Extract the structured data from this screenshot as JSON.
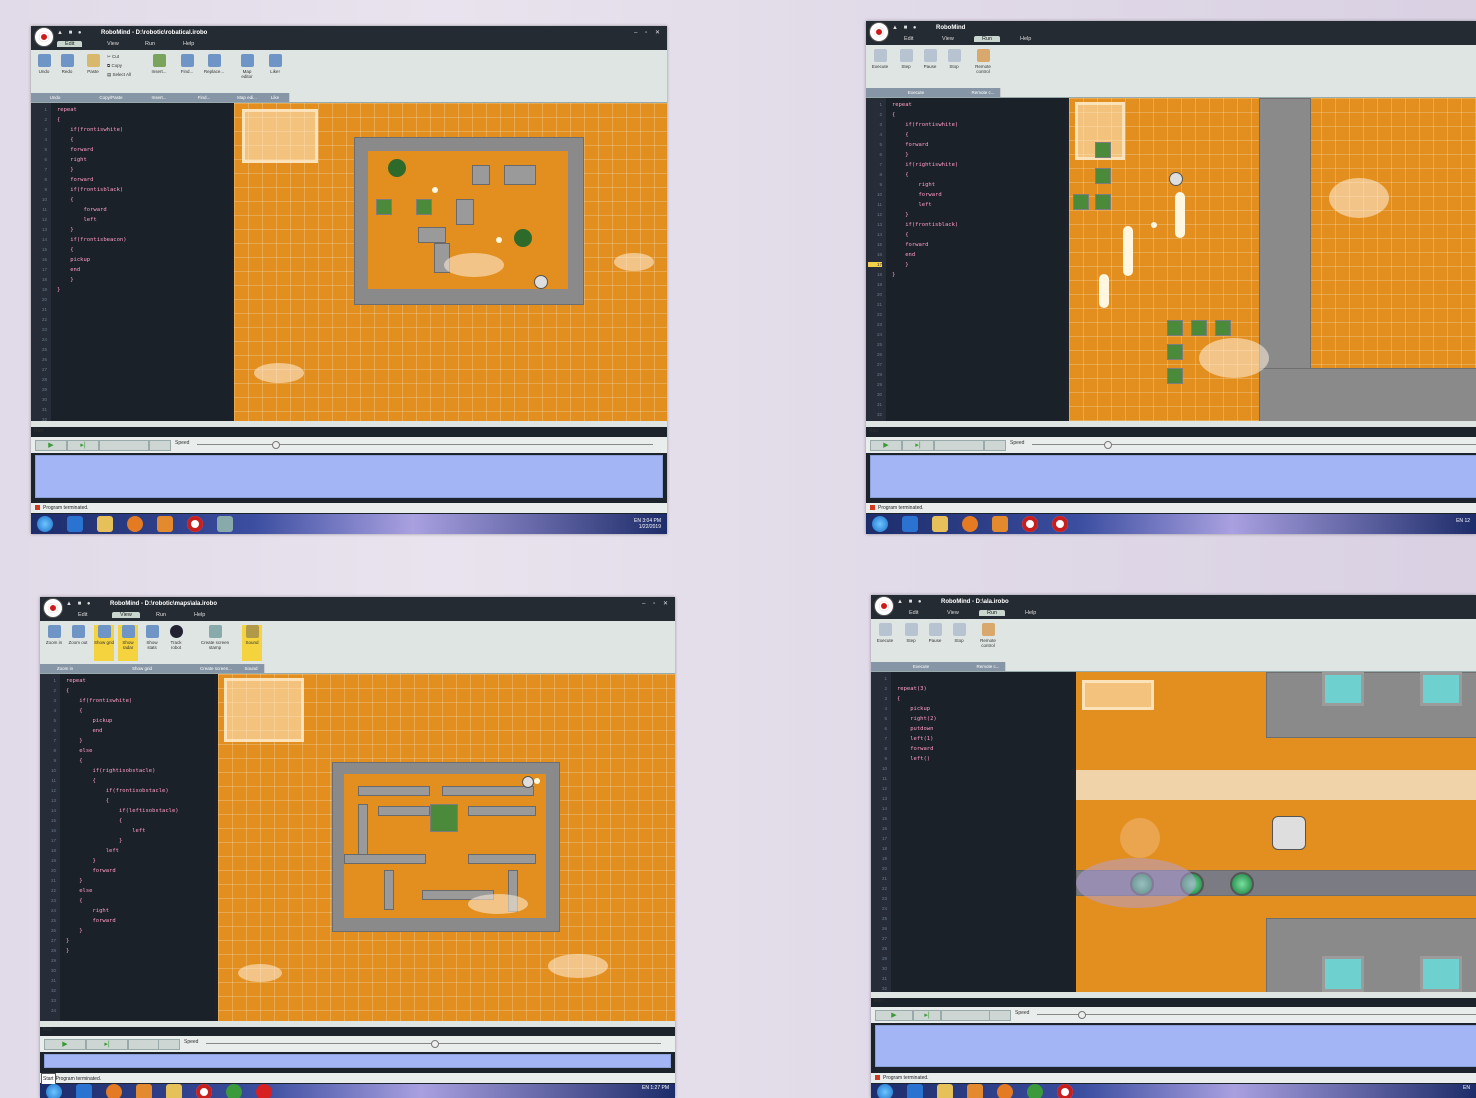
{
  "panels": [
    {
      "app_title": "RoboMind",
      "file_path": "D:\\robotic\\robatical.irobo",
      "menu": [
        "Edit",
        "View",
        "Run",
        "Help"
      ],
      "active_menu": "Edit",
      "ribbon_buttons": [
        "Undo",
        "Redo",
        "Paste",
        "Cut",
        "Copy",
        "Select All",
        "Insert...",
        "Find...",
        "Replace...",
        "Map editor",
        "Like!"
      ],
      "ribbon_groups": [
        "Undo",
        "Copy/Paste",
        "Insert...",
        "Find...",
        "Map edi...",
        "Like"
      ],
      "line_numbers": [
        "1",
        "2",
        "3",
        "4",
        "5",
        "6",
        "7",
        "8",
        "9",
        "10",
        "11",
        "12",
        "13",
        "14",
        "15",
        "16",
        "17",
        "18",
        "19",
        "20",
        "21",
        "22",
        "23",
        "24",
        "25",
        "26",
        "27",
        "28",
        "29",
        "30",
        "31",
        "32"
      ],
      "code": [
        "repeat",
        "{",
        "    if(frontiswhite)",
        "    {",
        "    forward",
        "    right",
        "    }",
        "    forward",
        "    if(frontisblack)",
        "    {",
        "        forward",
        "        left",
        "    }",
        "    if(frontisbeacon)",
        "    {",
        "    pickup",
        "    end",
        "    }",
        "}"
      ],
      "run_label": "Run",
      "speed_label": "Speed",
      "speed_value": 0.17,
      "status_text": "Program terminated.",
      "tray_time": "3:04 PM",
      "tray_date": "1/22/2019",
      "tray_lang": "EN"
    },
    {
      "app_title": "RoboMind",
      "menu": [
        "Edit",
        "View",
        "Run",
        "Help"
      ],
      "active_menu": "Run",
      "ribbon_buttons": [
        "Execute",
        "Step",
        "Pause",
        "Stop",
        "Remote control"
      ],
      "ribbon_groups": [
        "Execute",
        "Remote c..."
      ],
      "line_numbers": [
        "1",
        "2",
        "3",
        "4",
        "5",
        "6",
        "7",
        "8",
        "9",
        "10",
        "11",
        "12",
        "13",
        "14",
        "15",
        "16",
        "17",
        "18",
        "19",
        "20",
        "21",
        "22",
        "23",
        "24",
        "25",
        "26",
        "27",
        "28",
        "29",
        "30",
        "31",
        "32"
      ],
      "code": [
        "repeat",
        "{",
        "    if(frontiswhite)",
        "    {",
        "    forward",
        "    }",
        "    if(rightiswhite)",
        "    {",
        "        right",
        "        forward",
        "        left",
        "    }",
        "    if(frontisblack)",
        "    {",
        "    forward",
        "    end",
        "    }",
        "}"
      ],
      "run_label": "Run",
      "speed_label": "Speed",
      "speed_value": 0.17,
      "status_text": "Program terminated.",
      "tray_time": "12",
      "tray_lang": "EN"
    },
    {
      "app_title": "RoboMind",
      "file_path": "D:\\robotic\\maps\\ala.irobo",
      "menu": [
        "Edit",
        "View",
        "Run",
        "Help"
      ],
      "active_menu": "View",
      "ribbon_buttons": [
        "Zoom in",
        "Zoom out",
        "Show grid",
        "Show radar",
        "Show stats",
        "Track robot",
        "Create screen stamp",
        "Sound"
      ],
      "ribbon_groups": [
        "Zoom in",
        "Show grid",
        "Create screen...",
        "Sound"
      ],
      "line_numbers": [
        "1",
        "2",
        "3",
        "4",
        "5",
        "6",
        "7",
        "8",
        "9",
        "10",
        "11",
        "12",
        "13",
        "14",
        "15",
        "16",
        "17",
        "18",
        "19",
        "20",
        "21",
        "22",
        "23",
        "24",
        "25",
        "26",
        "27",
        "28",
        "29",
        "30",
        "31",
        "32",
        "33",
        "34"
      ],
      "code": [
        "repeat",
        "{",
        "    if(frontiswhite)",
        "    {",
        "        pickup",
        "        end",
        "    }",
        "    else",
        "    {",
        "        if(rightisobstacle)",
        "        {",
        "            if(frontisobstacle)",
        "            {",
        "                if(leftisobstacle)",
        "                {",
        "                    left",
        "                }",
        "            left",
        "        }",
        "        forward",
        "    }",
        "    else",
        "    {",
        "        right",
        "        forward",
        "    }",
        "}",
        "}"
      ],
      "run_label": "Run",
      "speed_label": "Speed",
      "speed_value": 0.5,
      "start_tip": "Start",
      "status_text": "Program terminated.",
      "tray_time": "1:27 PM",
      "tray_lang": "EN"
    },
    {
      "app_title": "RoboMind",
      "file_path": "D:\\ala.irobo",
      "menu": [
        "Edit",
        "View",
        "Run",
        "Help"
      ],
      "active_menu": "Run",
      "ribbon_buttons": [
        "Execute",
        "Step",
        "Pause",
        "Stop",
        "Remote control"
      ],
      "ribbon_groups": [
        "Execute",
        "Remote c..."
      ],
      "line_numbers": [
        "1",
        "2",
        "3",
        "4",
        "5",
        "6",
        "7",
        "8",
        "9",
        "10",
        "11",
        "12",
        "13",
        "14",
        "15",
        "16",
        "17",
        "18",
        "19",
        "20",
        "21",
        "22",
        "23",
        "24",
        "25",
        "26",
        "27",
        "28",
        "29",
        "30",
        "31",
        "32"
      ],
      "code": [
        "repeat(3)",
        "{",
        "    pickup",
        "    right(2)",
        "    putdown",
        "    left(1)",
        "    forward",
        "    left()"
      ],
      "run_label": "Run",
      "speed_label": "Speed",
      "speed_value": 0.1,
      "status_text": "Program terminated.",
      "tray_lang": "EN"
    }
  ],
  "colors": {
    "world_sand": "#e28f1f",
    "wall_grey": "#8a8a8a",
    "editor_bg": "#1b2129",
    "keyword_pink": "#ff9fc5",
    "output_blue": "#a4b5f5"
  }
}
